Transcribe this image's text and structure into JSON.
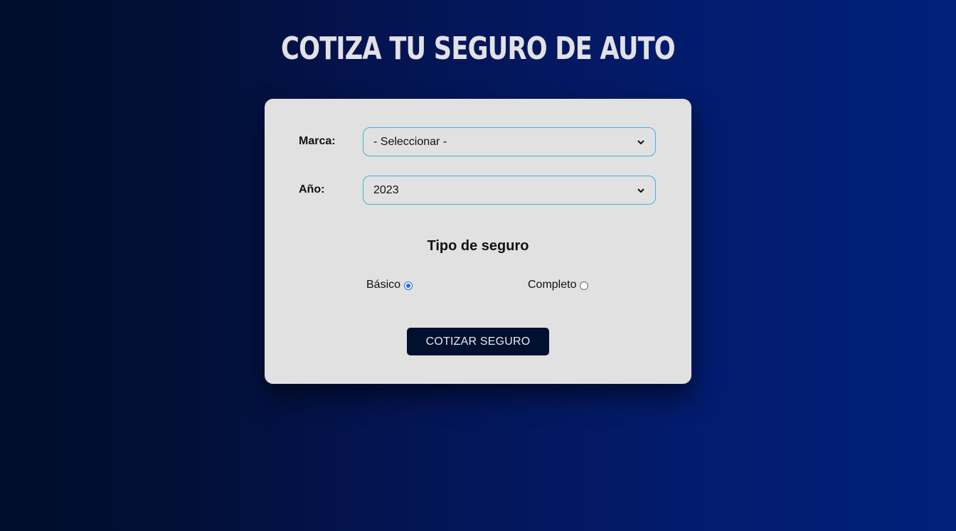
{
  "page": {
    "title": "Cotiza tu Seguro de Auto"
  },
  "form": {
    "brand": {
      "label": "Marca:",
      "selected": "- Seleccionar -"
    },
    "year": {
      "label": "Año:",
      "selected": "2023"
    },
    "insurance_type": {
      "heading": "Tipo de seguro",
      "options": [
        {
          "label": "Básico",
          "checked": true
        },
        {
          "label": "Completo",
          "checked": false
        }
      ]
    },
    "submit_label": "Cotizar Seguro"
  },
  "colors": {
    "background_gradient": [
      "#000d2b",
      "#00207a"
    ],
    "card": "#e1e1e1",
    "select_border": "#3fb0e8",
    "button": "#00102e",
    "radio_checked": "#1a6fe0"
  },
  "icons": {
    "select_arrow": "chevron-down-icon"
  }
}
